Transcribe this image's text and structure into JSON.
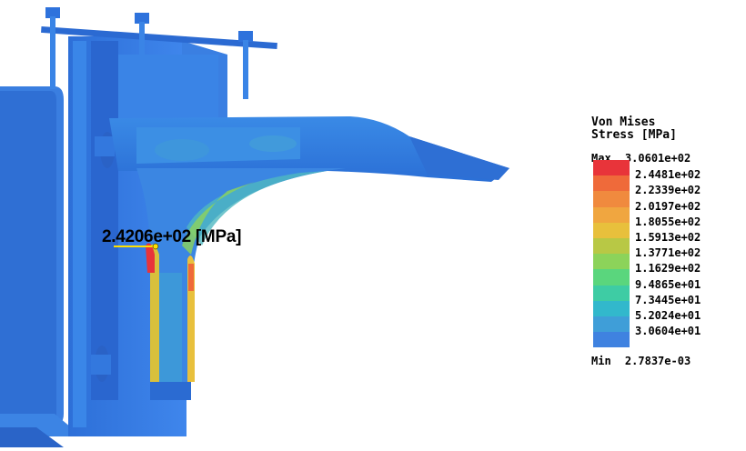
{
  "probe": {
    "label": "2.4206e+02 [MPa]",
    "marker_color": "#ffe000"
  },
  "legend": {
    "title_line1": "Von Mises",
    "title_line2": "Stress [MPa]",
    "max_label": "Max",
    "max_value": "3.0601e+02",
    "min_label": "Min",
    "min_value": "2.7837e-03",
    "levels": [
      "2.4481e+02",
      "2.2339e+02",
      "2.0197e+02",
      "1.8055e+02",
      "1.5913e+02",
      "1.3771e+02",
      "1.1629e+02",
      "9.4865e+01",
      "7.3445e+01",
      "5.2024e+01",
      "3.0604e+01"
    ],
    "colors": [
      "#e8343a",
      "#ef6a3a",
      "#f08a3e",
      "#f0a640",
      "#e8c03c",
      "#b8c845",
      "#8cd35a",
      "#5ad67d",
      "#3ecca4",
      "#32b8cc",
      "#3f9ed8",
      "#3f82e0"
    ]
  }
}
